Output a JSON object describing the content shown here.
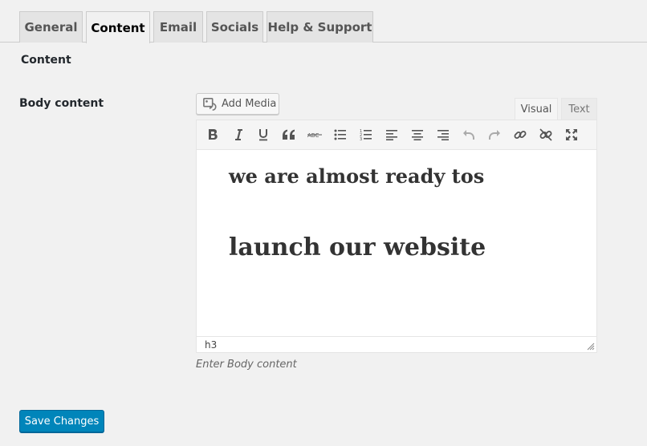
{
  "tabs": [
    {
      "label": "General"
    },
    {
      "label": "Content",
      "active": true
    },
    {
      "label": "Email"
    },
    {
      "label": "Socials"
    },
    {
      "label": "Help & Support"
    }
  ],
  "section_title": "Content",
  "field": {
    "label": "Body content",
    "description": "Enter Body content"
  },
  "editor": {
    "add_media_label": "Add Media",
    "mode_tabs": {
      "visual": "Visual",
      "text": "Text"
    },
    "active_mode": "Visual",
    "toolbar_icons": [
      "bold-icon",
      "italic-icon",
      "underline-icon",
      "blockquote-icon",
      "strikethrough-icon",
      "bullet-list-icon",
      "numbered-list-icon",
      "align-left-icon",
      "align-center-icon",
      "align-right-icon",
      "undo-icon",
      "redo-icon",
      "insert-link-icon",
      "remove-link-icon",
      "fullscreen-icon"
    ],
    "content": {
      "line1": "we are almost ready tos",
      "line2": "launch our website"
    },
    "status_path": "h3"
  },
  "save_button": "Save Changes",
  "colors": {
    "primary_button": "#0085ba",
    "background": "#f1f1f1"
  }
}
